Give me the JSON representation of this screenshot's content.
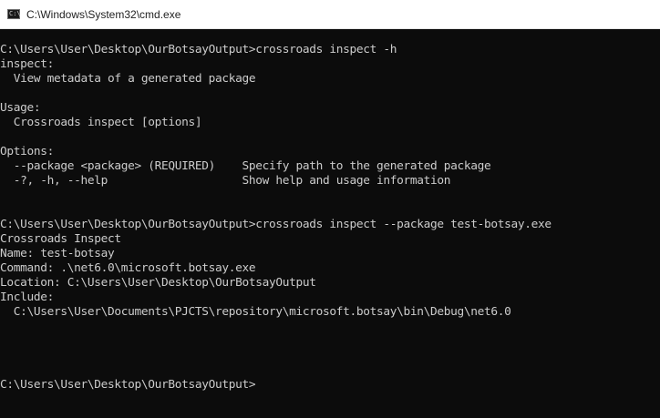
{
  "window": {
    "title": "C:\\Windows\\System32\\cmd.exe",
    "icon": "cmd-icon"
  },
  "console": {
    "lines": [
      "C:\\Users\\User\\Desktop\\OurBotsayOutput>crossroads inspect -h",
      "inspect:",
      "  View metadata of a generated package",
      "",
      "Usage:",
      "  Crossroads inspect [options]",
      "",
      "Options:",
      "  --package <package> (REQUIRED)    Specify path to the generated package",
      "  -?, -h, --help                    Show help and usage information",
      "",
      "",
      "C:\\Users\\User\\Desktop\\OurBotsayOutput>crossroads inspect --package test-botsay.exe",
      "Crossroads Inspect",
      "Name: test-botsay",
      "Command: .\\net6.0\\microsoft.botsay.exe",
      "Location: C:\\Users\\User\\Desktop\\OurBotsayOutput",
      "Include:",
      "  C:\\Users\\User\\Documents\\PJCTS\\repository\\microsoft.botsay\\bin\\Debug\\net6.0",
      "",
      "",
      "",
      "",
      "C:\\Users\\User\\Desktop\\OurBotsayOutput>"
    ]
  },
  "colors": {
    "background": "#0c0c0c",
    "foreground": "#cccccc",
    "titlebar": "#ffffff"
  }
}
